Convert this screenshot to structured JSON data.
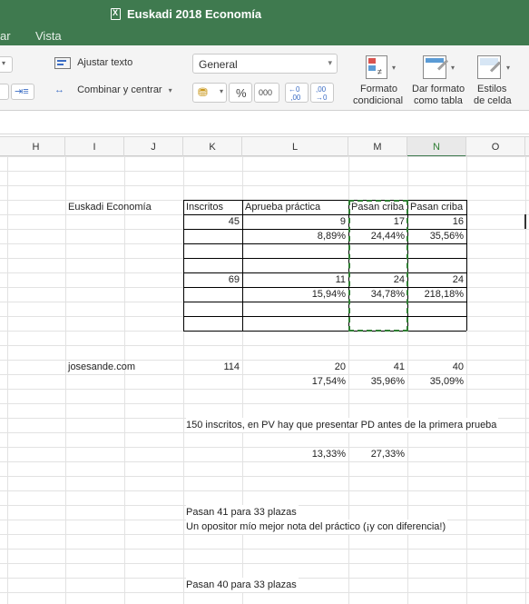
{
  "window": {
    "title": "Euskadi 2018 Economía"
  },
  "menu": {
    "tab_partial": "ar",
    "tab_vista": "Vista"
  },
  "ribbon": {
    "wrap_text": "Ajustar texto",
    "merge_center": "Combinar y centrar",
    "number_format": "General",
    "percent": "%",
    "thousands": "000",
    "cond_format_line1": "Formato",
    "cond_format_line2": "condicional",
    "format_table_line1": "Dar formato",
    "format_table_line2": "como tabla",
    "cell_styles_line1": "Estilos",
    "cell_styles_line2": "de celda"
  },
  "columns": [
    "H",
    "I",
    "J",
    "K",
    "L",
    "M",
    "N",
    "O"
  ],
  "sheet": {
    "block1": {
      "label": "Euskadi Economía",
      "h_inscritos": "Inscritos",
      "h_aprueba": "Aprueba práctica",
      "h_pasan_m": "Pasan criba",
      "h_pasan_n": "Pasan criba",
      "r1_k": "45",
      "r1_l": "9",
      "r1_m": "17",
      "r1_n": "16",
      "r2_l": "8,89%",
      "r2_m": "24,44%",
      "r2_n": "35,56%",
      "r5_k": "69",
      "r5_l": "11",
      "r5_m": "24",
      "r5_n": "24",
      "r6_l": "15,94%",
      "r6_m": "34,78%",
      "r6_n": "218,18%"
    },
    "block2": {
      "label": "josesande.com",
      "k": "114",
      "l": "20",
      "m": "41",
      "n": "40",
      "pl": "17,54%",
      "pm": "35,96%",
      "pn": "35,09%"
    },
    "note1": "150 inscritos, en PV hay que presentar PD antes de la primera prueba",
    "note1_l": "13,33%",
    "note1_m": "27,33%",
    "note2": "Pasan 41 para 33 plazas",
    "note3": "Un opositor mío mejor nota del práctico (¡y con diferencia!)",
    "note4": "Pasan 40 para 33 plazas"
  }
}
